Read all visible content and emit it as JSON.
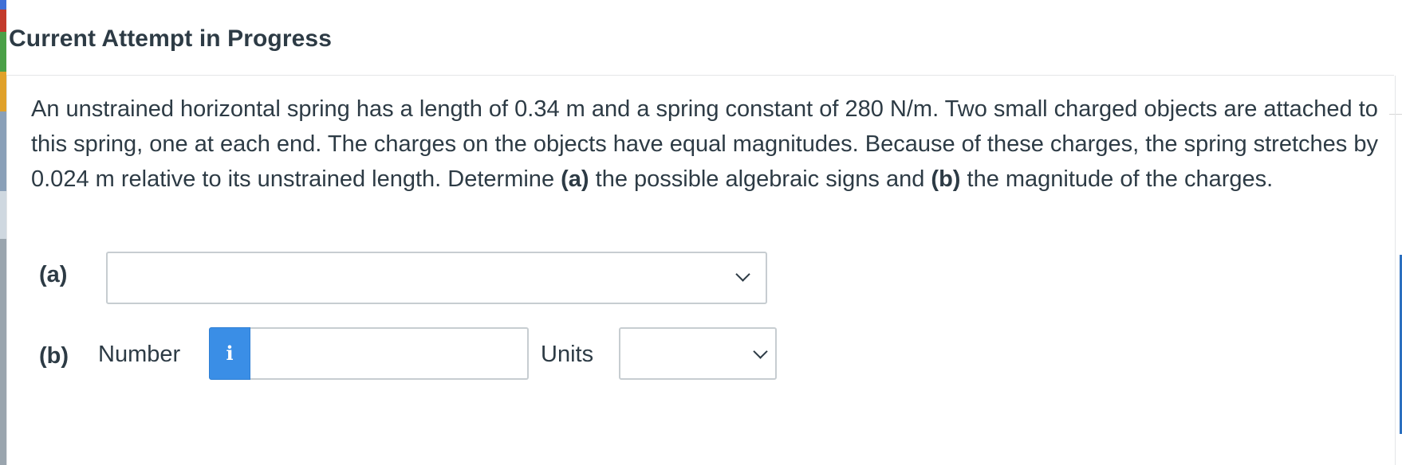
{
  "header": {
    "title": "Current Attempt in Progress"
  },
  "question": {
    "text_1": "An unstrained horizontal spring has a length of 0.34 m and a spring constant of 280 N/m. Two small charged objects are attached to this spring, one at each end. The charges on the objects have equal magnitudes. Because of these charges, the spring stretches by 0.024 m relative to its unstrained length. Determine ",
    "bold_a": "(a)",
    "text_2": " the possible algebraic signs and ",
    "bold_b": "(b)",
    "text_3": " the magnitude of the charges."
  },
  "part_a": {
    "label": "(a)",
    "selected_value": "",
    "icon": "chevron-down-icon"
  },
  "part_b": {
    "label": "(b)",
    "number_label": "Number",
    "info_icon": "i",
    "number_value": "",
    "units_label": "Units",
    "units_selected": "",
    "icon": "chevron-down-icon"
  },
  "colors": {
    "text": "#2d3b45",
    "info_button": "#3a8ee6",
    "border": "#c7cdd1",
    "right_accent": "#2b6fbf"
  }
}
